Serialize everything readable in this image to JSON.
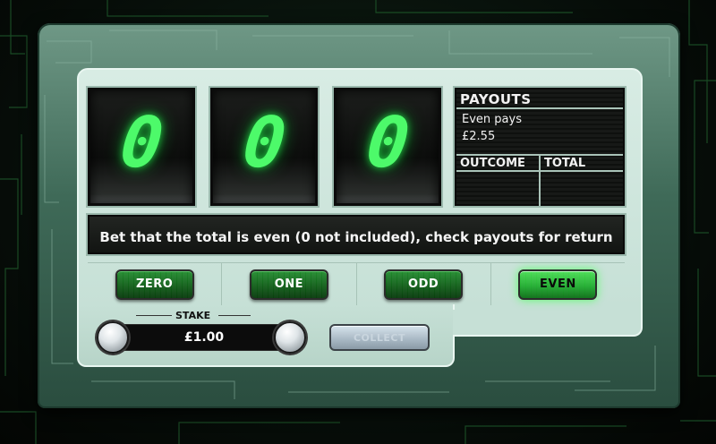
{
  "reels": [
    {
      "value": "0"
    },
    {
      "value": "0"
    },
    {
      "value": "0"
    }
  ],
  "payouts": {
    "title": "PAYOUTS",
    "line1": "Even pays",
    "line2": "£2.55",
    "col_outcome": "OUTCOME",
    "col_total": "TOTAL"
  },
  "message": "Bet that the total is even  (0 not included), check payouts for return",
  "bets": [
    {
      "label": "ZERO",
      "selected": false
    },
    {
      "label": "ONE",
      "selected": false
    },
    {
      "label": "ODD",
      "selected": false
    },
    {
      "label": "EVEN",
      "selected": true
    }
  ],
  "stake": {
    "label": "STAKE",
    "value": "£1.00"
  },
  "collect": {
    "label": "COLLECT",
    "enabled": false
  },
  "colors": {
    "digit": "#4dfa6a",
    "bet_button": "#0d5a14",
    "bet_selected": "#3cdc46",
    "panel": "#c6e0d6"
  }
}
